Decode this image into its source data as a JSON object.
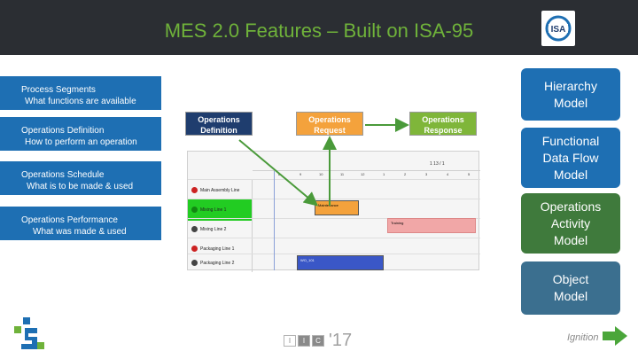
{
  "slide": {
    "title": "MES 2.0 Features – Built on ISA-95",
    "logo_text": "ISA"
  },
  "segments": [
    {
      "title": "Process Segments",
      "subtitle": "What functions are available"
    },
    {
      "title": "Operations Definition",
      "subtitle": "How to perform an operation"
    },
    {
      "title": "Operations Schedule",
      "subtitle": "What is to be made & used"
    },
    {
      "title": "Operations Performance",
      "subtitle": "What was made & used"
    }
  ],
  "right_boxes": [
    {
      "lines": [
        "Hierarchy",
        "Model"
      ],
      "color": "#1e6fb3"
    },
    {
      "lines": [
        "Functional",
        "Data Flow",
        "Model"
      ],
      "color": "#1e6fb3"
    },
    {
      "lines": [
        "Operations",
        "Activity",
        "Model"
      ],
      "color": "#3f7a3c"
    },
    {
      "lines": [
        "Object",
        "Model"
      ],
      "color": "#3b6f8f"
    }
  ],
  "tags": [
    {
      "line1": "Operations",
      "line2": "Definition",
      "bg": "#1f3d6e",
      "fg": "#ffffff"
    },
    {
      "line1": "Operations",
      "line2": "Request",
      "bg": "#f4a23c",
      "fg": "#ffffff"
    },
    {
      "line1": "Operations",
      "line2": "Response",
      "bg": "#7fb63a",
      "fg": "#ffffff"
    }
  ],
  "scheduler": {
    "date_header": "1 13 / 1",
    "ticks": [
      "8",
      "9",
      "10",
      "11",
      "12",
      "1",
      "2",
      "3",
      "4",
      "5"
    ],
    "rows": [
      {
        "label": "Main Assembly Line"
      },
      {
        "label": "Mixing Line 1"
      },
      {
        "label": "Mixing Line 2"
      },
      {
        "label": "Packaging Line 1"
      },
      {
        "label": "Packaging Line 2"
      }
    ],
    "events": [
      {
        "label": "Maintenance",
        "color": "#f4a23c"
      },
      {
        "label": "Training",
        "color": "#f1a7a7"
      },
      {
        "label": "WO_101",
        "color": "#3a57c7"
      }
    ]
  },
  "footer": {
    "year_boxes": [
      "I",
      "I",
      "C"
    ],
    "year_suffix": "'17",
    "brand": "Ignition"
  },
  "colors": {
    "header": "#2b2e33",
    "title": "#6fb23a",
    "segment_blue": "#1e6fb3",
    "arrow_green": "#4a9a3a"
  }
}
